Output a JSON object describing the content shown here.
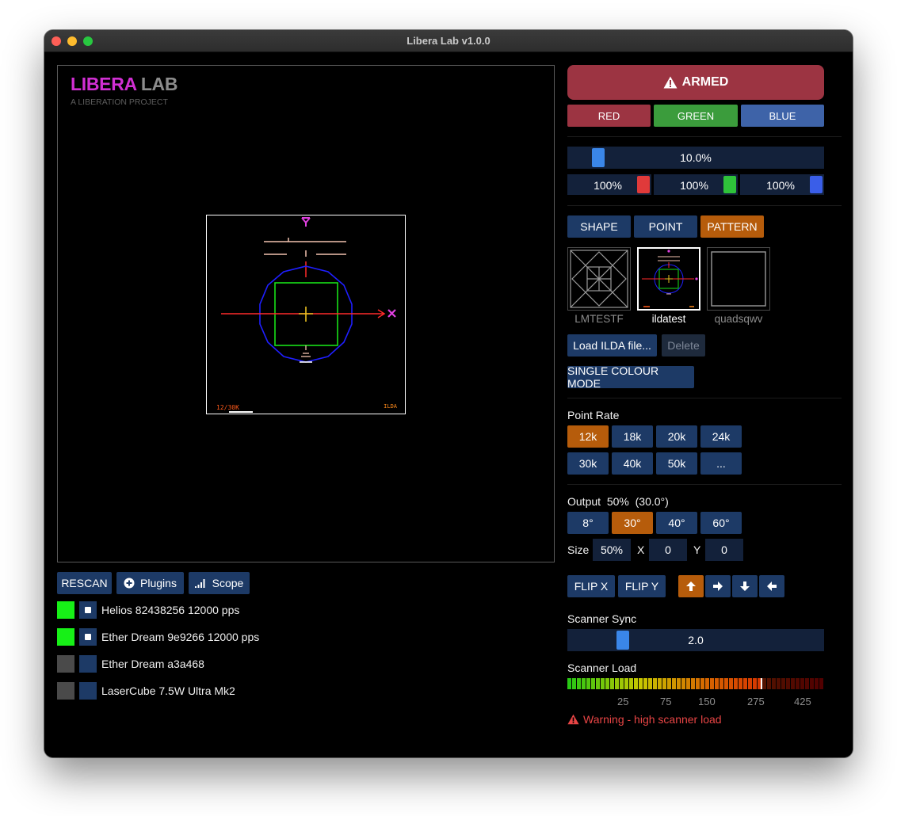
{
  "window": {
    "title": "Libera Lab v1.0.0"
  },
  "logo": {
    "part1": "LIBERA",
    "part2": "LAB",
    "tagline": "A LIBERATION PROJECT"
  },
  "preview": {
    "label_left": "12/30K",
    "label_right": "ILDA"
  },
  "left_buttons": {
    "rescan": "RESCAN",
    "plugins": "Plugins",
    "scope": "Scope"
  },
  "devices": [
    {
      "name": "Helios 82438256  12000 pps",
      "connected": true
    },
    {
      "name": "Ether Dream 9e9266  12000 pps",
      "connected": true
    },
    {
      "name": "Ether Dream a3a468",
      "connected": false
    },
    {
      "name": "LaserCube 7.5W Ultra Mk2",
      "connected": false
    }
  ],
  "armed": {
    "label": "ARMED"
  },
  "color_buttons": {
    "red": "RED",
    "green": "GREEN",
    "blue": "BLUE"
  },
  "master_brightness": {
    "label": "10.0%",
    "value": 0.1
  },
  "channel_levels": {
    "red": "100%",
    "green": "100%",
    "blue": "100%"
  },
  "mode_tabs": {
    "shape": "SHAPE",
    "point": "POINT",
    "pattern": "PATTERN",
    "active": "PATTERN"
  },
  "files": [
    {
      "name": "LMTESTF",
      "selected": false
    },
    {
      "name": "ildatest",
      "selected": true
    },
    {
      "name": "quadsqwv",
      "selected": false
    }
  ],
  "file_actions": {
    "load": "Load ILDA file...",
    "delete": "Delete",
    "single_colour": "SINGLE COLOUR MODE"
  },
  "point_rate": {
    "title": "Point Rate",
    "options": [
      "12k",
      "18k",
      "20k",
      "24k",
      "30k",
      "40k",
      "50k",
      "..."
    ],
    "active": "12k"
  },
  "output": {
    "title": "Output",
    "percent": "50%",
    "angle": "(30.0°)",
    "options": [
      "8°",
      "30°",
      "40°",
      "60°"
    ],
    "active": "30°"
  },
  "size": {
    "label": "Size",
    "value": "50%",
    "x_label": "X",
    "x_value": "0",
    "y_label": "Y",
    "y_value": "0"
  },
  "flip": {
    "x": "FLIP X",
    "y": "FLIP Y"
  },
  "scanner_sync": {
    "title": "Scanner Sync",
    "label": "2.0",
    "value": 2.0
  },
  "scanner_load": {
    "title": "Scanner Load",
    "ticks": [
      "25",
      "75",
      "150",
      "275",
      "425"
    ],
    "level": 0.756
  },
  "warning": {
    "text": "Warning - high scanner load"
  },
  "colors": {
    "accent_blue": "#1d3a66",
    "active_orange": "#b65c0b",
    "armed_red": "#9c3442",
    "warning": "#e84545"
  }
}
